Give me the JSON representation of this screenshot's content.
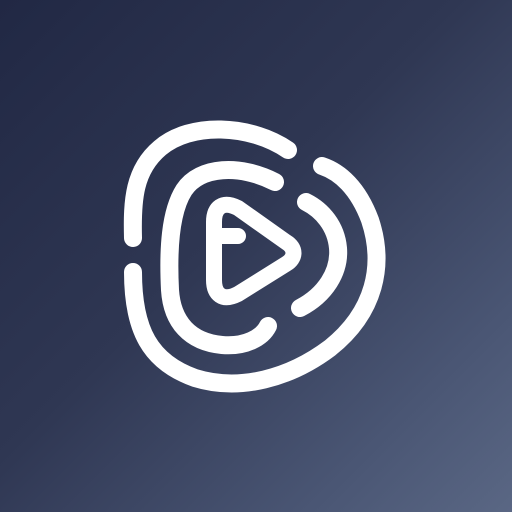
{
  "icon": {
    "name": "play-logo-icon",
    "foreground": "#ffffff",
    "background_start": "#212844",
    "background_end": "#5a6784"
  }
}
